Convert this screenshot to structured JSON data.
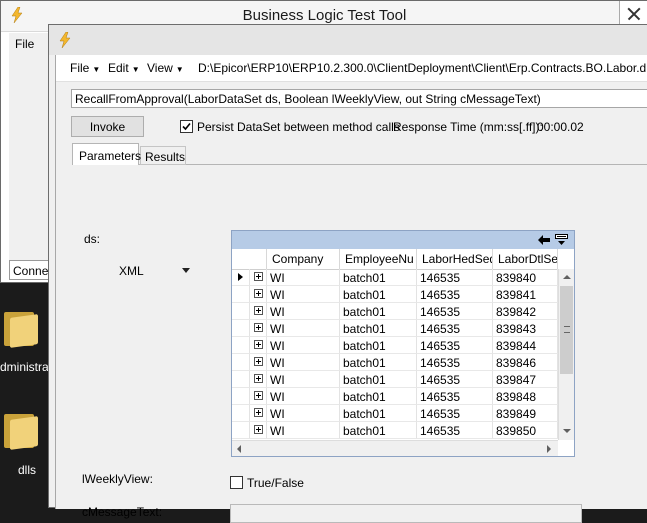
{
  "desktop": {
    "icons": [
      {
        "label": "dministra",
        "icon": "folder-icon"
      },
      {
        "label": "dlls",
        "icon": "folder-icon"
      }
    ]
  },
  "back_window": {
    "title": "Business Logic Test Tool",
    "file_menu": "File",
    "connection_tab": "Conne",
    "app_icon": "lightning-icon"
  },
  "front_window": {
    "app_icon": "lightning-icon",
    "menu": {
      "file": "File",
      "edit": "Edit",
      "view": "View",
      "dll_path": "D:\\Epicor\\ERP10\\ERP10.2.300.0\\ClientDeployment\\Client\\Erp.Contracts.BO.Labor.dll"
    },
    "method_signature": "RecallFromApproval(LaborDataSet  ds,  Boolean  lWeeklyView,  out  String  cMessageText)",
    "invoke_label": "Invoke",
    "persist_label": "Persist DataSet between method calls",
    "persist_checked": true,
    "response_time_label": "Response Time (mm:ss[.ff]):",
    "response_time_value": "00:00.02",
    "tabs": [
      {
        "label": "Parameters",
        "active": true
      },
      {
        "label": "Results",
        "active": false
      }
    ],
    "params": {
      "ds_label": "ds:",
      "format_selected": "XML",
      "weekly_label": "lWeeklyView:",
      "weekly_checkbox_label": "True/False",
      "weekly_checked": false,
      "message_label": "cMessageText:",
      "message_value": ""
    },
    "grid": {
      "columns": [
        "Company",
        "EmployeeNu",
        "LaborHedSeq",
        "LaborDtlSeq"
      ],
      "rows": [
        [
          "WI",
          "batch01",
          "146535",
          "839840"
        ],
        [
          "WI",
          "batch01",
          "146535",
          "839841"
        ],
        [
          "WI",
          "batch01",
          "146535",
          "839842"
        ],
        [
          "WI",
          "batch01",
          "146535",
          "839843"
        ],
        [
          "WI",
          "batch01",
          "146535",
          "839844"
        ],
        [
          "WI",
          "batch01",
          "146535",
          "839846"
        ],
        [
          "WI",
          "batch01",
          "146535",
          "839847"
        ],
        [
          "WI",
          "batch01",
          "146535",
          "839848"
        ],
        [
          "WI",
          "batch01",
          "146535",
          "839849"
        ],
        [
          "WI",
          "batch01",
          "146535",
          "839850"
        ]
      ],
      "current_row": 0
    }
  }
}
